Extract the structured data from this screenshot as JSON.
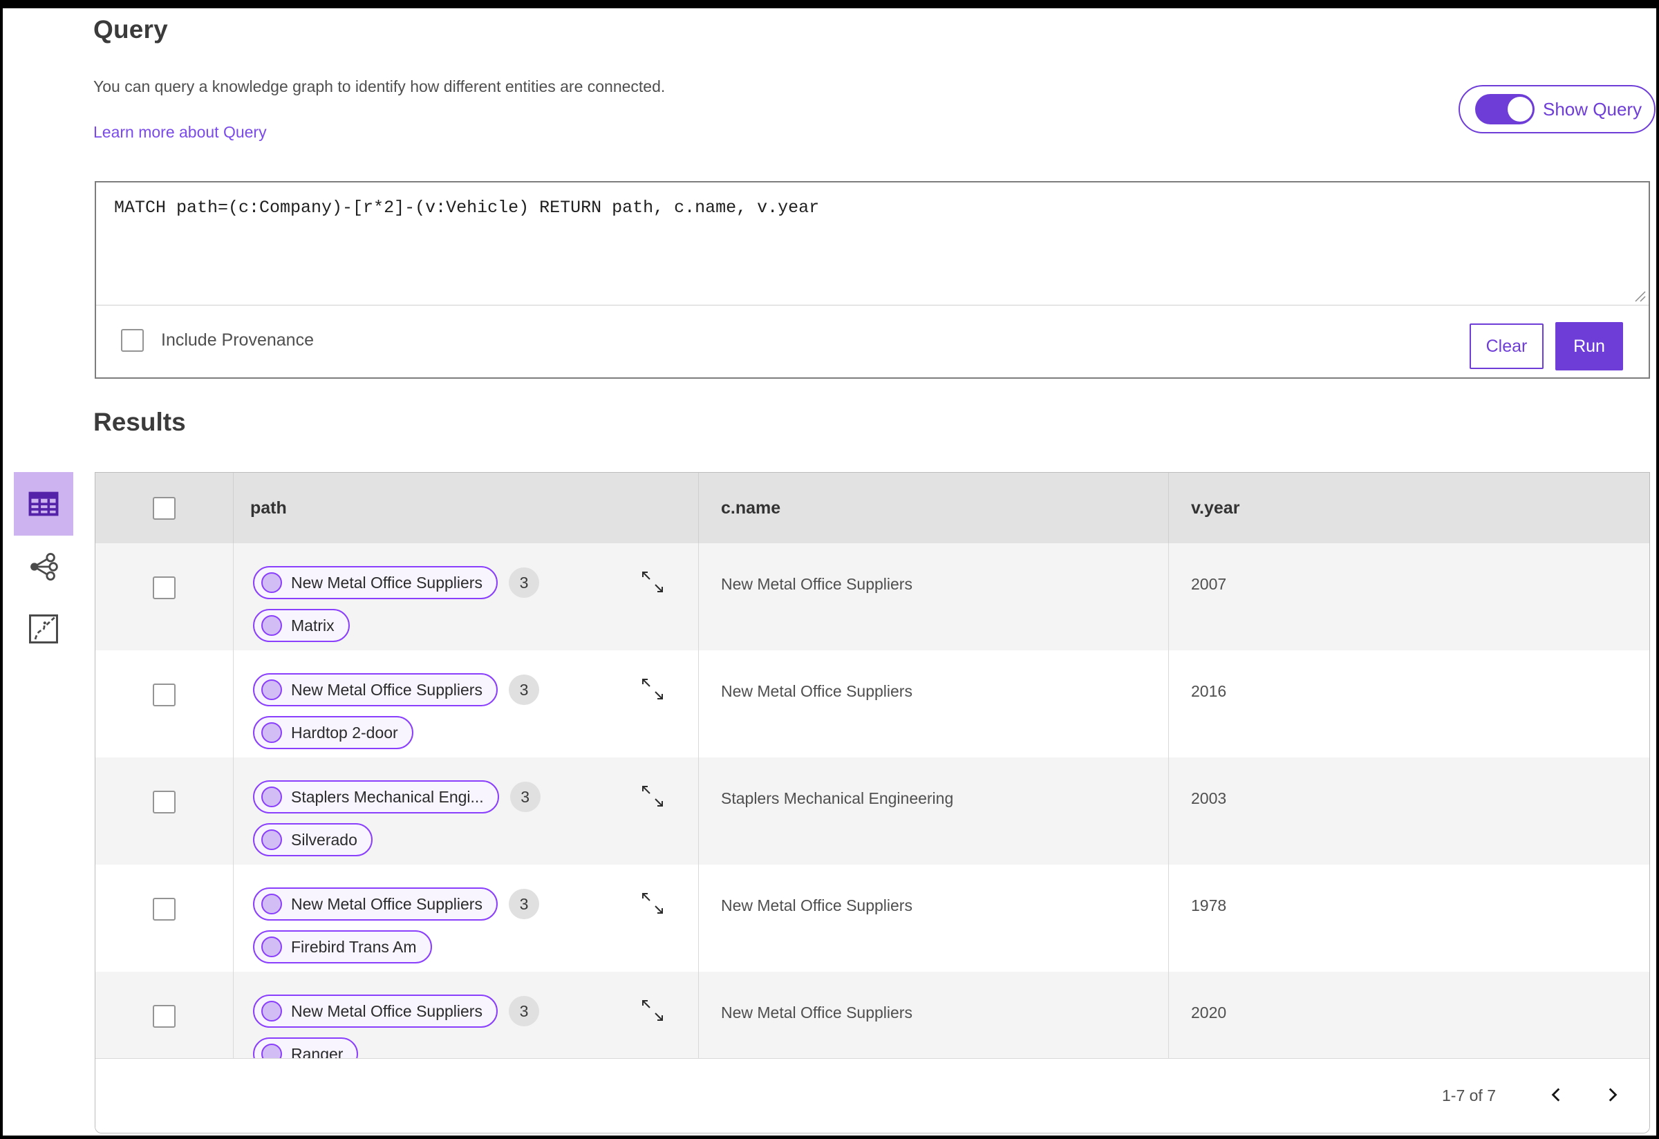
{
  "header": {
    "title": "Query",
    "description": "You can query a knowledge graph to identify how different entities are connected.",
    "learn_more_label": "Learn more about Query",
    "show_query_label": "Show Query",
    "show_query_state": "on"
  },
  "query_editor": {
    "query_text": "MATCH path=(c:Company)-[r*2]-(v:Vehicle) RETURN path, c.name, v.year",
    "include_provenance_label": "Include Provenance",
    "include_provenance_checked": false,
    "clear_label": "Clear",
    "run_label": "Run"
  },
  "view_switcher": {
    "items": [
      {
        "icon": "table-view-icon",
        "selected": true
      },
      {
        "icon": "graph-view-icon",
        "selected": false
      },
      {
        "icon": "chart-view-icon",
        "selected": false
      }
    ]
  },
  "results": {
    "title": "Results",
    "columns": [
      "path",
      "c.name",
      "v.year"
    ],
    "rows": [
      {
        "pills": [
          {
            "label": "New Metal Office Suppliers",
            "badge": "3"
          },
          {
            "label": "Matrix"
          }
        ],
        "c_name": "New Metal Office Suppliers",
        "v_year": "2007"
      },
      {
        "pills": [
          {
            "label": "New Metal Office Suppliers",
            "badge": "3"
          },
          {
            "label": "Hardtop 2-door"
          }
        ],
        "c_name": "New Metal Office Suppliers",
        "v_year": "2016"
      },
      {
        "pills": [
          {
            "label": "Staplers Mechanical Engi...",
            "badge": "3"
          },
          {
            "label": "Silverado"
          }
        ],
        "c_name": "Staplers Mechanical Engineering",
        "v_year": "2003"
      },
      {
        "pills": [
          {
            "label": "New Metal Office Suppliers",
            "badge": "3"
          },
          {
            "label": "Firebird Trans Am"
          }
        ],
        "c_name": "New Metal Office Suppliers",
        "v_year": "1978"
      },
      {
        "pills": [
          {
            "label": "New Metal Office Suppliers",
            "badge": "3"
          },
          {
            "label": "Ranger"
          }
        ],
        "c_name": "New Metal Office Suppliers",
        "v_year": "2020"
      }
    ],
    "pagination": {
      "range_label": "1-7 of 7"
    }
  },
  "colors": {
    "accent": "#6e3dd8",
    "accent_dark": "#5422a8",
    "link": "#7a4bea",
    "pill_border": "#8a3ffc",
    "pill_bg": "#f8f5ff",
    "pill_dot": "#d3bdf5",
    "selected_tile_bg": "#cdb3f0",
    "row_alt": "#f4f4f4",
    "table_header_bg": "#e2e2e2",
    "badge_bg": "#e0e0e0"
  }
}
